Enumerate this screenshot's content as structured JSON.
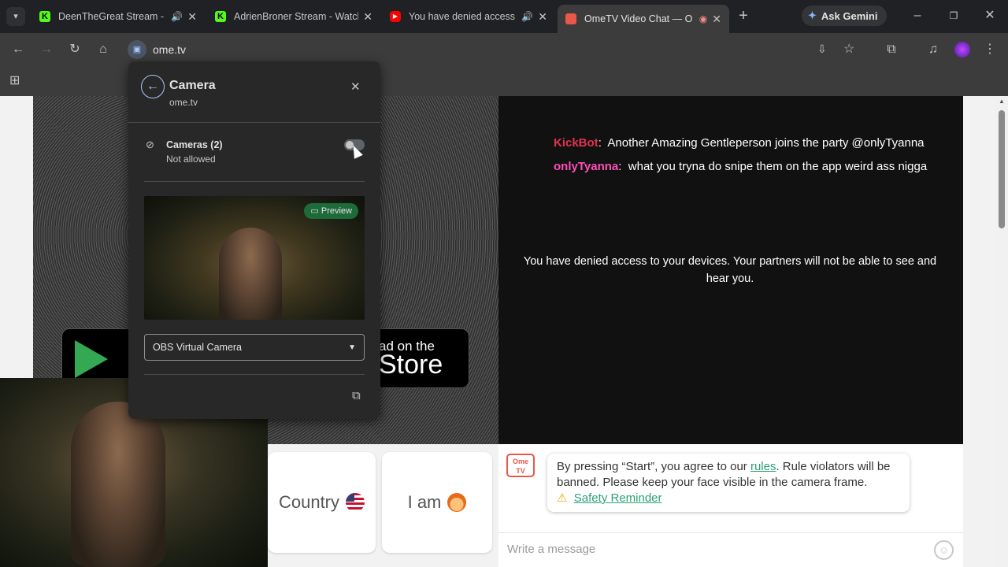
{
  "tabs": [
    {
      "title": "DeenTheGreat Stream - W",
      "favicon_color": "#53fc18",
      "has_sound": true
    },
    {
      "title": "AdrienBroner Stream - Watch",
      "favicon_color": "#53fc18",
      "has_sound": false
    },
    {
      "title": "You have denied access t",
      "favicon_color": "#ff0000",
      "has_sound": true
    },
    {
      "title": "OmeTV Video Chat — O",
      "favicon_color": "#e8574a",
      "has_sound": false,
      "active": true
    }
  ],
  "new_tab_label": "+",
  "gemini_label": "Ask Gemini",
  "address": "ome.tv",
  "popup": {
    "title": "Camera",
    "site": "ome.tv",
    "cameras_label": "Cameras (2)",
    "cameras_status": "Not allowed",
    "preview_badge": "Preview",
    "selected_camera": "OBS Virtual Camera"
  },
  "chat": {
    "messages": [
      {
        "name": "KickBot",
        "text": "Another Amazing Gentleperson joins the party @onlyTyanna",
        "color": "#e0334f"
      },
      {
        "name": "onlyTyanna",
        "text": "what you tryna do snipe them on the app weird ass nigga",
        "color": "#ff4fb8"
      }
    ],
    "denied_notice": "You have denied access to your devices. Your partners will not be able to see and hear you."
  },
  "store_badge": {
    "text_small": "ad on the",
    "text_big": "Store"
  },
  "buttons": {
    "country_label": "Country",
    "gender_label": "I am"
  },
  "notice": {
    "part1": "By pressing “Start”, you agree to our ",
    "rules_link": "rules",
    "part2": ". Rule violators will be banned. Please keep your face visible in the camera frame.",
    "safety_link": "Safety Reminder"
  },
  "message_input": {
    "placeholder": "Write a message"
  }
}
